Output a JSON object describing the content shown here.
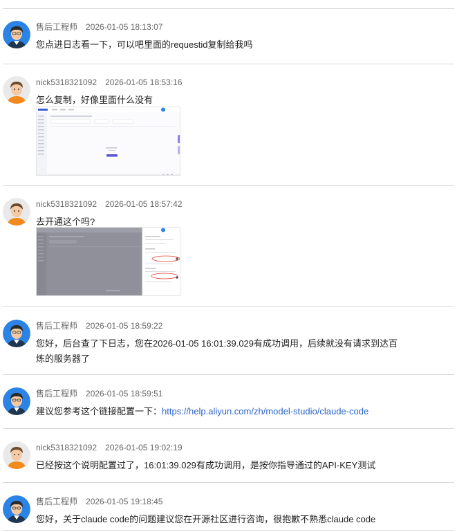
{
  "messages": [
    {
      "author": "售后工程师",
      "time": "2026-01-05 18:13:07",
      "role": "engineer",
      "text": "您点进日志看一下，可以吧里面的requestid复制给我吗"
    },
    {
      "author": "nick5318321092",
      "time": "2026-01-05 18:53:16",
      "role": "user",
      "text": "怎么复制，好像里面什么没有",
      "attachments": [
        "screenshot-console-log"
      ]
    },
    {
      "author": "nick5318321092",
      "time": "2026-01-05 18:57:42",
      "role": "user",
      "text": "去开通这个吗?",
      "attachments": [
        "screenshot-console-dimmed",
        "screenshot-activation-panel"
      ]
    },
    {
      "author": "售后工程师",
      "time": "2026-01-05 18:59:22",
      "role": "engineer",
      "text_line1": "您好，后台查了下日志，您在2026-01-05 16:01:39.029有成功调用，后续就没有请求到达百",
      "text_line2": "炼的服务器了"
    },
    {
      "author": "售后工程师",
      "time": "2026-01-05 18:59:51",
      "role": "engineer",
      "text": "建议您参考这个链接配置一下：",
      "link": "https://help.aliyun.com/zh/model-studio/claude-code"
    },
    {
      "author": "nick5318321092",
      "time": "2026-01-05 19:02:19",
      "role": "user",
      "text": "已经按这个说明配置过了，16:01:39.029有成功调用，是按你指导通过的API-KEY测试"
    },
    {
      "author": "售后工程师",
      "time": "2026-01-05 19:18:45",
      "role": "engineer",
      "text": "您好，关于claude code的问题建议您在开源社区进行咨询，很抱歉不熟悉claude code"
    }
  ],
  "colors": {
    "link": "#2a63c8",
    "divider": "#d8d8d8",
    "meta": "#666666",
    "engineer_bg": "#2b83e6",
    "user_shirt": "#f28a1e"
  }
}
